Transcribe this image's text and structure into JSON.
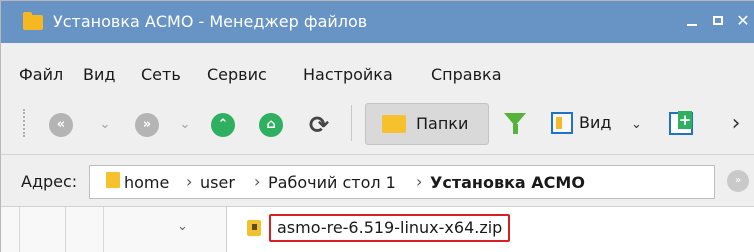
{
  "window": {
    "title": "Установка АСМО - Менеджер файлов",
    "controls": [
      "minimize",
      "maximize",
      "close"
    ]
  },
  "menu": {
    "items": [
      "Файл",
      "Вид",
      "Сеть",
      "Сервис",
      "Настройка",
      "Справка"
    ]
  },
  "toolbar": {
    "folders_label": "Папки",
    "view_label": "Вид",
    "icons": [
      "back-icon",
      "dropdown-icon",
      "forward-icon",
      "dropdown-icon",
      "up-icon",
      "home-icon",
      "refresh-icon",
      "folders-icon",
      "filter-icon",
      "view-icon",
      "new-panel-icon",
      "more-icon"
    ]
  },
  "address": {
    "label": "Адрес:",
    "crumbs": [
      "home",
      "user",
      "Рабочий стол 1",
      "Установка АСМО"
    ]
  },
  "files": {
    "items": [
      {
        "name": "asmo-re-6.519-linux-x64.zip"
      }
    ]
  },
  "colors": {
    "titlebar": "#6793c5",
    "accent_green": "#2fb061",
    "highlight_red": "#d82020",
    "folder_yellow": "#f6c12c"
  }
}
